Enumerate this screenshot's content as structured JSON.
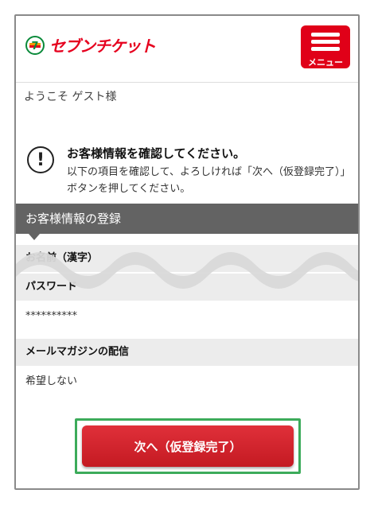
{
  "header": {
    "logo_text": "セブンチケット",
    "logo_mark_text": "7",
    "menu_label": "メニュー"
  },
  "welcome_text": "ようこそ ゲスト様",
  "notice": {
    "icon_glyph": "!",
    "title": "お客様情報を確認してください。",
    "body": "以下の項目を確認して、よろしければ「次へ（仮登録完了）」ボタンを押してください。"
  },
  "section_title": "お客様情報の登録",
  "fields": [
    {
      "label": "お名前（漢字）",
      "value": ""
    },
    {
      "label": "パスワード",
      "value": "**********"
    },
    {
      "label": "メールマガジンの配信",
      "value": "希望しない"
    }
  ],
  "next_button_label": "次へ（仮登録完了）",
  "colors": {
    "brand_red": "#e6001e",
    "section_gray": "#636363",
    "highlight_green": "#3cab5a"
  }
}
